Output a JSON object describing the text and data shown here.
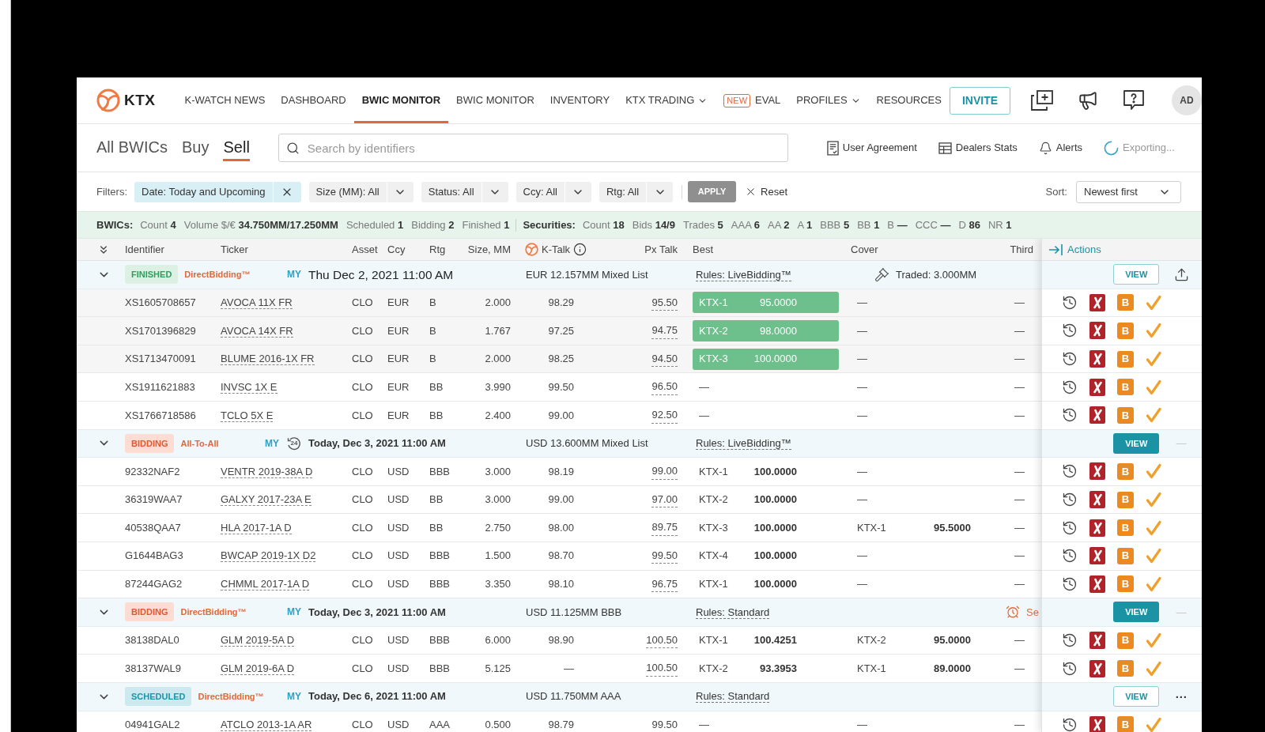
{
  "nav": {
    "logo": "KTX",
    "items": [
      {
        "label": "K-WATCH NEWS",
        "selected": false,
        "dropdown": false
      },
      {
        "label": "DASHBOARD",
        "selected": false,
        "dropdown": false
      },
      {
        "label": "BWIC MONITOR",
        "selected": true,
        "dropdown": false
      },
      {
        "label": "BWIC MONITOR",
        "selected": false,
        "dropdown": false
      },
      {
        "label": "INVENTORY",
        "selected": false,
        "dropdown": false
      },
      {
        "label": "KTX TRADING",
        "selected": false,
        "dropdown": true
      },
      {
        "label": "EVAL",
        "selected": false,
        "dropdown": false,
        "badge": "NEW"
      },
      {
        "label": "PROFILES",
        "selected": false,
        "dropdown": true
      },
      {
        "label": "RESOURCES",
        "selected": false,
        "dropdown": false
      }
    ],
    "invite": "INVITE",
    "avatar": "AD"
  },
  "view_tabs": [
    {
      "label": "All BWICs",
      "selected": false
    },
    {
      "label": "Buy",
      "selected": false
    },
    {
      "label": "Sell",
      "selected": true
    }
  ],
  "search": {
    "placeholder": "Search by identifiers"
  },
  "links": [
    {
      "label": "User Agreement",
      "kind": "agreement"
    },
    {
      "label": "Dealers Stats",
      "kind": "stats"
    },
    {
      "label": "Alerts",
      "kind": "alerts"
    },
    {
      "label": "Exporting...",
      "kind": "exporting"
    }
  ],
  "filters": {
    "label": "Filters:",
    "chips": [
      {
        "label": "Date: Today and Upcoming",
        "kind": "applied"
      },
      {
        "label": "Size (MM): All",
        "kind": "dropdown"
      },
      {
        "label": "Status: All",
        "kind": "dropdown"
      },
      {
        "label": "Ccy: All",
        "kind": "dropdown"
      },
      {
        "label": "Rtg: All",
        "kind": "dropdown"
      }
    ],
    "apply": {
      "label": "APPLY",
      "disabled": true
    },
    "reset": "Reset"
  },
  "sort": {
    "label": "Sort:",
    "value": "Newest first"
  },
  "summary": [
    {
      "title": "BWICs:",
      "stats": [
        {
          "label": "Count",
          "value": "4"
        },
        {
          "label": "Volume $/€",
          "value": "34.750MM/17.250MM"
        },
        {
          "label": "Scheduled",
          "value": "1"
        },
        {
          "label": "Bidding",
          "value": "2"
        },
        {
          "label": "Finished",
          "value": "1"
        }
      ]
    },
    {
      "title": "Securities:",
      "stats": [
        {
          "label": "Count",
          "value": "18"
        },
        {
          "label": "Bids",
          "value": "14/9"
        },
        {
          "label": "Trades",
          "value": "5"
        },
        {
          "label": "AAA",
          "value": "6"
        },
        {
          "label": "AA",
          "value": "2"
        },
        {
          "label": "A",
          "value": "1"
        },
        {
          "label": "BBB",
          "value": "5"
        },
        {
          "label": "BB",
          "value": "1"
        },
        {
          "label": "B",
          "value": "—"
        },
        {
          "label": "CCC",
          "value": "—"
        },
        {
          "label": "D",
          "value": "86"
        },
        {
          "label": "NR",
          "value": "1"
        }
      ]
    }
  ],
  "table": {
    "columns": {
      "identifier": "Identifier",
      "ticker": "Ticker",
      "asset": "Asset",
      "ccy": "Ccy",
      "rtg": "Rtg",
      "size": "Size, MM",
      "k_talk": "K-Talk",
      "px_talk": "Px Talk",
      "best": "Best",
      "cover": "Cover",
      "third": "Third"
    },
    "actions": "Actions",
    "groups": [
      {
        "status": "FINISHED",
        "kind": "finished",
        "expanded": true,
        "type": "DirectBidding™",
        "owner": "MY",
        "date": "Thu Dec 2, 2021 11:00 AM",
        "summary": "EUR 12.157MM Mixed List",
        "rules": "Rules: LiveBidding™",
        "note": {
          "kind": "traded",
          "text": "Traded: 3.000MM"
        },
        "view": {
          "label": "VIEW",
          "filled": false
        },
        "trailing": {
          "kind": "export"
        },
        "rows": [
          {
            "identifier": "XS1605708657",
            "ticker": "AVOCA 11X FR",
            "asset": "CLO",
            "ccy": "EUR",
            "rtg": "B",
            "size": "2.000",
            "k_talk": "98.29",
            "px_talk": "95.50",
            "best": {
              "dealer": "KTX-1",
              "price": "95.0000"
            },
            "traded": true,
            "cover": {
              "text": "—"
            },
            "third": "—",
            "action_badge": "B"
          },
          {
            "identifier": "XS1701396829",
            "ticker": "AVOCA 14X FR",
            "asset": "CLO",
            "ccy": "EUR",
            "rtg": "B",
            "size": "1.767",
            "k_talk": "97.25",
            "px_talk": "94.75",
            "best": {
              "dealer": "KTX-2",
              "price": "98.0000"
            },
            "traded": true,
            "cover": {
              "text": "—"
            },
            "third": "—",
            "action_badge": "B"
          },
          {
            "identifier": "XS1713470091",
            "ticker": "BLUME 2016-1X FR",
            "asset": "CLO",
            "ccy": "EUR",
            "rtg": "B",
            "size": "2.000",
            "k_talk": "98.25",
            "px_talk": "94.50",
            "best": {
              "dealer": "KTX-3",
              "price": "100.0000"
            },
            "traded": true,
            "cover": {
              "text": "—"
            },
            "third": "—",
            "action_badge": "B"
          },
          {
            "identifier": "XS1911621883",
            "ticker": "INVSC 1X E",
            "asset": "CLO",
            "ccy": "EUR",
            "rtg": "BB",
            "size": "3.990",
            "k_talk": "99.50",
            "px_talk": "96.50",
            "best": {
              "text": "—"
            },
            "traded": false,
            "cover": {
              "text": "—"
            },
            "third": "—",
            "action_badge": "B"
          },
          {
            "identifier": "XS1766718586",
            "ticker": "TCLO 5X E",
            "asset": "CLO",
            "ccy": "EUR",
            "rtg": "BB",
            "size": "2.400",
            "k_talk": "99.00",
            "px_talk": "92.50",
            "best": {
              "text": "—"
            },
            "traded": false,
            "cover": {
              "text": "—"
            },
            "third": "—",
            "action_badge": "B"
          }
        ]
      },
      {
        "status": "BIDDING",
        "kind": "bidding",
        "expanded": true,
        "type": "All-To-All",
        "owner": "MY",
        "clock": "24",
        "date": "Today, Dec 3, 2021 11:00 AM",
        "summary": "USD 13.600MM Mixed List",
        "rules": "Rules: LiveBidding™",
        "view": {
          "label": "VIEW",
          "filled": true
        },
        "trailing": {
          "kind": "dash",
          "text": "—"
        },
        "rows": [
          {
            "identifier": "92332NAF2",
            "ticker": "VENTR 2019-38A D",
            "asset": "CLO",
            "ccy": "USD",
            "rtg": "BBB",
            "size": "3.000",
            "k_talk": "98.19",
            "px_talk": "99.00",
            "best": {
              "dealer": "KTX-1",
              "price": "100.0000"
            },
            "traded": false,
            "cover": {
              "text": "—"
            },
            "third": "—",
            "action_badge": "B"
          },
          {
            "identifier": "36319WAA7",
            "ticker": "GALXY 2017-23A E",
            "asset": "CLO",
            "ccy": "USD",
            "rtg": "BB",
            "size": "3.000",
            "k_talk": "99.00",
            "px_talk": "97.00",
            "best": {
              "dealer": "KTX-2",
              "price": "100.0000"
            },
            "traded": false,
            "cover": {
              "text": "—"
            },
            "third": "—",
            "action_badge": "B"
          },
          {
            "identifier": "40538QAA7",
            "ticker": "HLA 2017-1A D",
            "asset": "CLO",
            "ccy": "USD",
            "rtg": "BB",
            "size": "2.750",
            "k_talk": "98.00",
            "px_talk": "89.75",
            "best": {
              "dealer": "KTX-3",
              "price": "100.0000"
            },
            "traded": false,
            "cover": {
              "dealer": "KTX-1",
              "price": "95.5000"
            },
            "third": "—",
            "action_badge": "B"
          },
          {
            "identifier": "G1644BAG3",
            "ticker": "BWCAP 2019-1X D2",
            "asset": "CLO",
            "ccy": "USD",
            "rtg": "BBB",
            "size": "1.500",
            "k_talk": "98.70",
            "px_talk": "99.50",
            "best": {
              "dealer": "KTX-4",
              "price": "100.0000"
            },
            "traded": false,
            "cover": {
              "text": "—"
            },
            "third": "—",
            "action_badge": "B"
          },
          {
            "identifier": "87244GAG2",
            "ticker": "CHMML 2017-1A D",
            "asset": "CLO",
            "ccy": "USD",
            "rtg": "BBB",
            "size": "3.350",
            "k_talk": "98.10",
            "px_talk": "96.75",
            "best": {
              "dealer": "KTX-1",
              "price": "100.0000"
            },
            "traded": false,
            "cover": {
              "text": "—"
            },
            "third": "—",
            "action_badge": "B"
          }
        ]
      },
      {
        "status": "BIDDING",
        "kind": "bidding",
        "expanded": true,
        "type": "DirectBidding™",
        "owner": "MY",
        "date": "Today, Dec 3, 2021 11:00 AM",
        "summary": "USD 11.125MM BBB",
        "rules": "Rules: Standard",
        "note": {
          "kind": "timer",
          "text": "Se"
        },
        "view": {
          "label": "VIEW",
          "filled": true
        },
        "trailing": {
          "kind": "dash",
          "text": "—"
        },
        "rows": [
          {
            "identifier": "38138DAL0",
            "ticker": "GLM 2019-5A D",
            "asset": "CLO",
            "ccy": "USD",
            "rtg": "BBB",
            "size": "6.000",
            "k_talk": "98.90",
            "px_talk": "100.50",
            "best": {
              "dealer": "KTX-1",
              "price": "100.4251"
            },
            "traded": false,
            "cover": {
              "dealer": "KTX-2",
              "price": "95.0000"
            },
            "third": "—",
            "action_badge": "B"
          },
          {
            "identifier": "38137WAL9",
            "ticker": "GLM 2019-6A D",
            "asset": "CLO",
            "ccy": "USD",
            "rtg": "BBB",
            "size": "5.125",
            "k_talk": "—",
            "px_talk": "100.50",
            "best": {
              "dealer": "KTX-2",
              "price": "93.3953"
            },
            "traded": false,
            "cover": {
              "dealer": "KTX-1",
              "price": "89.0000"
            },
            "third": "—",
            "action_badge": "B"
          }
        ]
      },
      {
        "status": "SCHEDULED",
        "kind": "scheduled",
        "expanded": true,
        "type": "DirectBidding™",
        "owner": "MY",
        "date": "Today, Dec 6, 2021 11:00 AM",
        "summary": "USD 11.750MM AAA",
        "rules": "Rules: Standard",
        "view": {
          "label": "VIEW",
          "filled": false
        },
        "trailing": {
          "kind": "more",
          "text": "···"
        },
        "rows": [
          {
            "identifier": "04941GAL2",
            "ticker": "ATCLO 2013-1A AR",
            "asset": "CLO",
            "ccy": "USD",
            "rtg": "AAA",
            "size": "0.500",
            "k_talk": "98.79",
            "px_talk": "99.50",
            "best": {
              "text": "—"
            },
            "traded": false,
            "cover": {
              "text": "—"
            },
            "third": "—",
            "action_badge": "B"
          }
        ]
      }
    ]
  }
}
